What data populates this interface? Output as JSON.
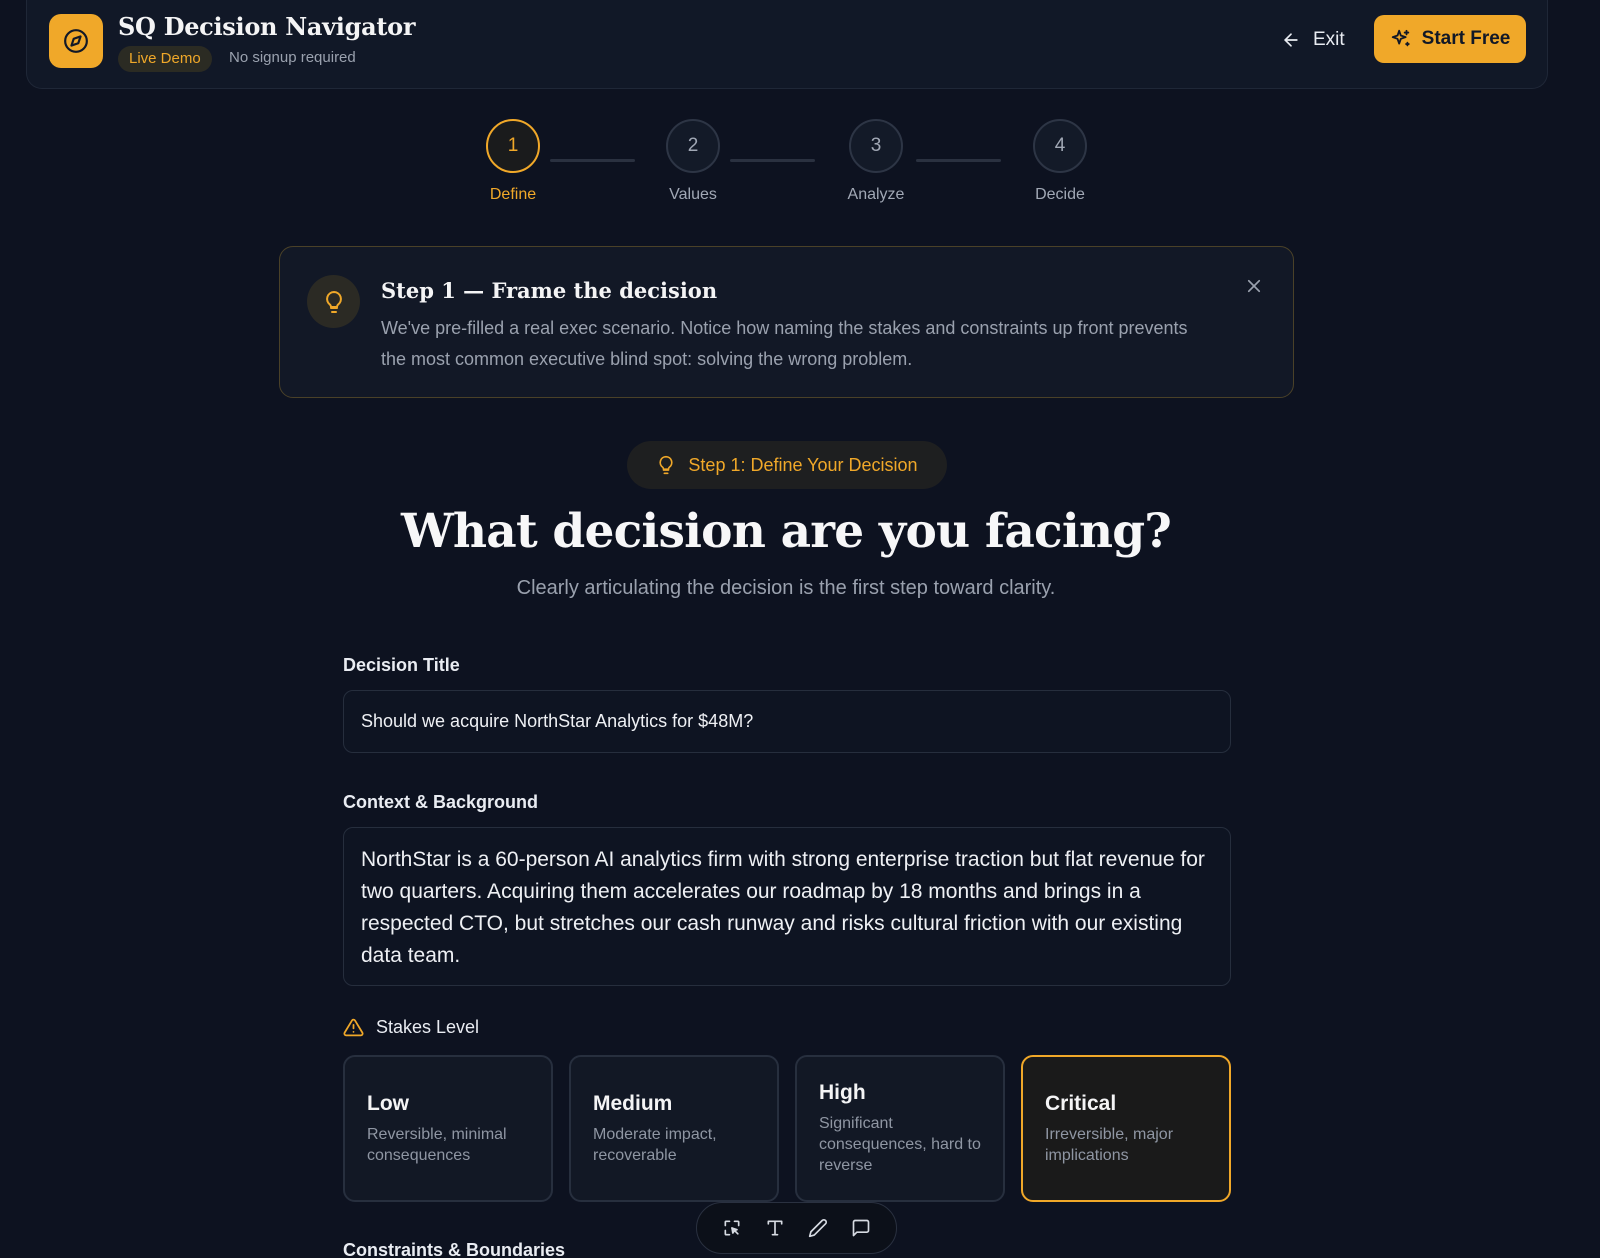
{
  "header": {
    "app_title": "SQ Decision Navigator",
    "badge": "Live Demo",
    "subtitle": "No signup required",
    "logo_icon": "compass-icon",
    "exit_label": "Exit",
    "start_label": "Start Free"
  },
  "stepper": {
    "current": 1,
    "steps": [
      {
        "number": "1",
        "label": "Define"
      },
      {
        "number": "2",
        "label": "Values"
      },
      {
        "number": "3",
        "label": "Analyze"
      },
      {
        "number": "4",
        "label": "Decide"
      }
    ]
  },
  "tip": {
    "title": "Step 1 — Frame the decision",
    "text": "We've pre-filled a real exec scenario. Notice how naming the stakes and constraints up front prevents the most common executive blind spot: solving the wrong problem."
  },
  "main": {
    "step_pill": "Step 1: Define Your Decision",
    "heading": "What decision are you facing?",
    "subheading": "Clearly articulating the decision is the first step toward clarity."
  },
  "form": {
    "title_label": "Decision Title",
    "title_value": "Should we acquire NorthStar Analytics for $48M?",
    "context_label": "Context & Background",
    "context_value": "NorthStar is a 60-person AI analytics firm with strong enterprise traction but flat revenue for two quarters. Acquiring them accelerates our roadmap by 18 months and brings in a respected CTO, but stretches our cash runway and risks cultural friction with our existing data team.",
    "stakes_label": "Stakes Level",
    "stakes": [
      {
        "name": "Low",
        "desc": "Reversible, minimal consequences"
      },
      {
        "name": "Medium",
        "desc": "Moderate impact, recoverable"
      },
      {
        "name": "High",
        "desc": "Significant consequences, hard to reverse"
      },
      {
        "name": "Critical",
        "desc": "Irreversible, major implications"
      }
    ],
    "selected_stake": "Critical",
    "constraints_label": "Constraints & Boundaries"
  },
  "colors": {
    "accent": "#f0a829",
    "background": "#0d1220",
    "surface": "#111827"
  }
}
